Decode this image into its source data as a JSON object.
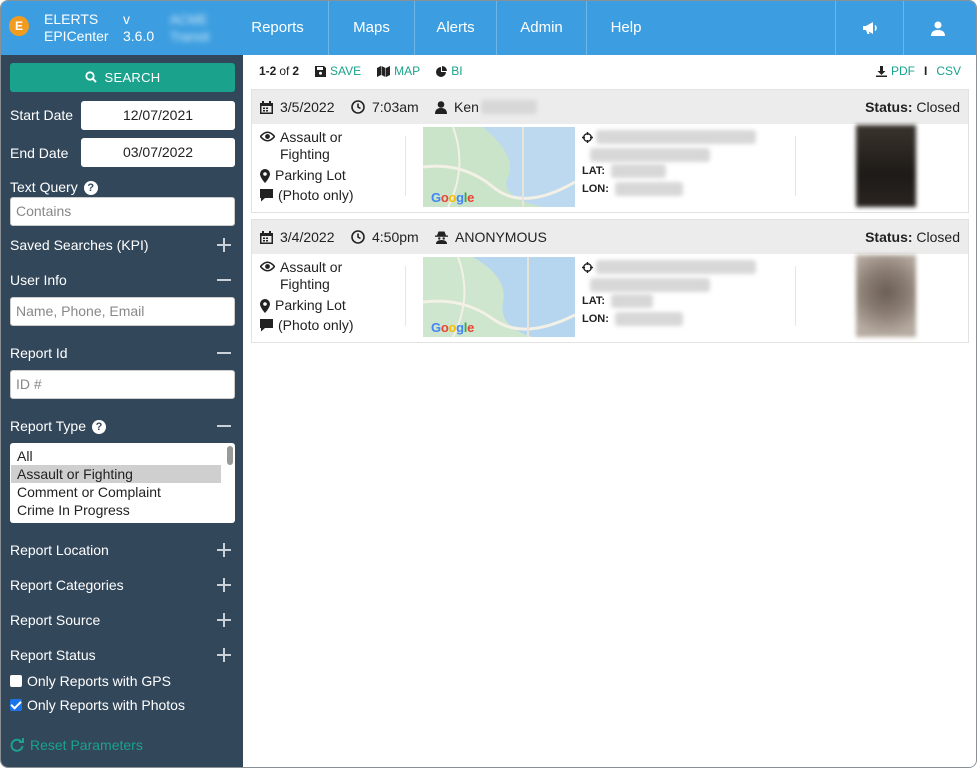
{
  "app": {
    "brand_line1": "ELERTS",
    "brand_line2": "EPICenter",
    "version_prefix": "v",
    "version": "3.6.0",
    "org_line1": "ACME",
    "org_line2": "Transit",
    "logo_letter": "E"
  },
  "nav": [
    {
      "label": "Reports"
    },
    {
      "label": "Maps"
    },
    {
      "label": "Alerts"
    },
    {
      "label": "Admin"
    },
    {
      "label": "Help"
    }
  ],
  "nav_icons": [
    "megaphone-icon",
    "user-icon"
  ],
  "colors": {
    "topbar": "#3c9ee0",
    "sidebar": "#33475b",
    "accent": "#1aa28c",
    "logo": "#f29c1f"
  },
  "sidebar": {
    "search_label": "SEARCH",
    "start_date_label": "Start Date",
    "start_date_value": "12/07/2021",
    "end_date_label": "End Date",
    "end_date_value": "03/07/2022",
    "text_query_label": "Text Query",
    "text_query_placeholder": "Contains",
    "saved_searches_label": "Saved Searches (KPI)",
    "user_info_label": "User Info",
    "user_info_placeholder": "Name, Phone, Email",
    "report_id_label": "Report Id",
    "report_id_placeholder": "ID #",
    "report_type_label": "Report Type",
    "report_type_options": [
      "All",
      "Assault or Fighting",
      "Comment or Complaint",
      "Crime In Progress"
    ],
    "report_type_selected": "Assault or Fighting",
    "report_location_label": "Report Location",
    "report_categories_label": "Report Categories",
    "report_source_label": "Report Source",
    "report_status_label": "Report Status",
    "gps_only_label": "Only Reports with GPS",
    "gps_only_checked": false,
    "photos_only_label": "Only Reports with Photos",
    "photos_only_checked": true,
    "reset_label": "Reset Parameters"
  },
  "toolbar": {
    "range": "1-2",
    "of": "of",
    "total": "2",
    "save_label": "SAVE",
    "map_label": "MAP",
    "bi_label": "BI",
    "pdf_label": "PDF",
    "separator": "I",
    "csv_label": "CSV"
  },
  "reports": [
    {
      "date": "3/5/2022",
      "time": "7:03am",
      "reporter": "Ken",
      "reporter_icon": "user-icon",
      "status_label": "Status:",
      "status": "Closed",
      "type": "Assault or Fighting",
      "location": "Parking Lot",
      "message": "(Photo only)",
      "lat_label": "LAT:",
      "lon_label": "LON:"
    },
    {
      "date": "3/4/2022",
      "time": "4:50pm",
      "reporter": "ANONYMOUS",
      "reporter_icon": "anonymous-icon",
      "status_label": "Status:",
      "status": "Closed",
      "type": "Assault or Fighting",
      "location": "Parking Lot",
      "message": "(Photo only)",
      "lat_label": "LAT:",
      "lon_label": "LON:"
    }
  ],
  "map_attribution": "Google"
}
